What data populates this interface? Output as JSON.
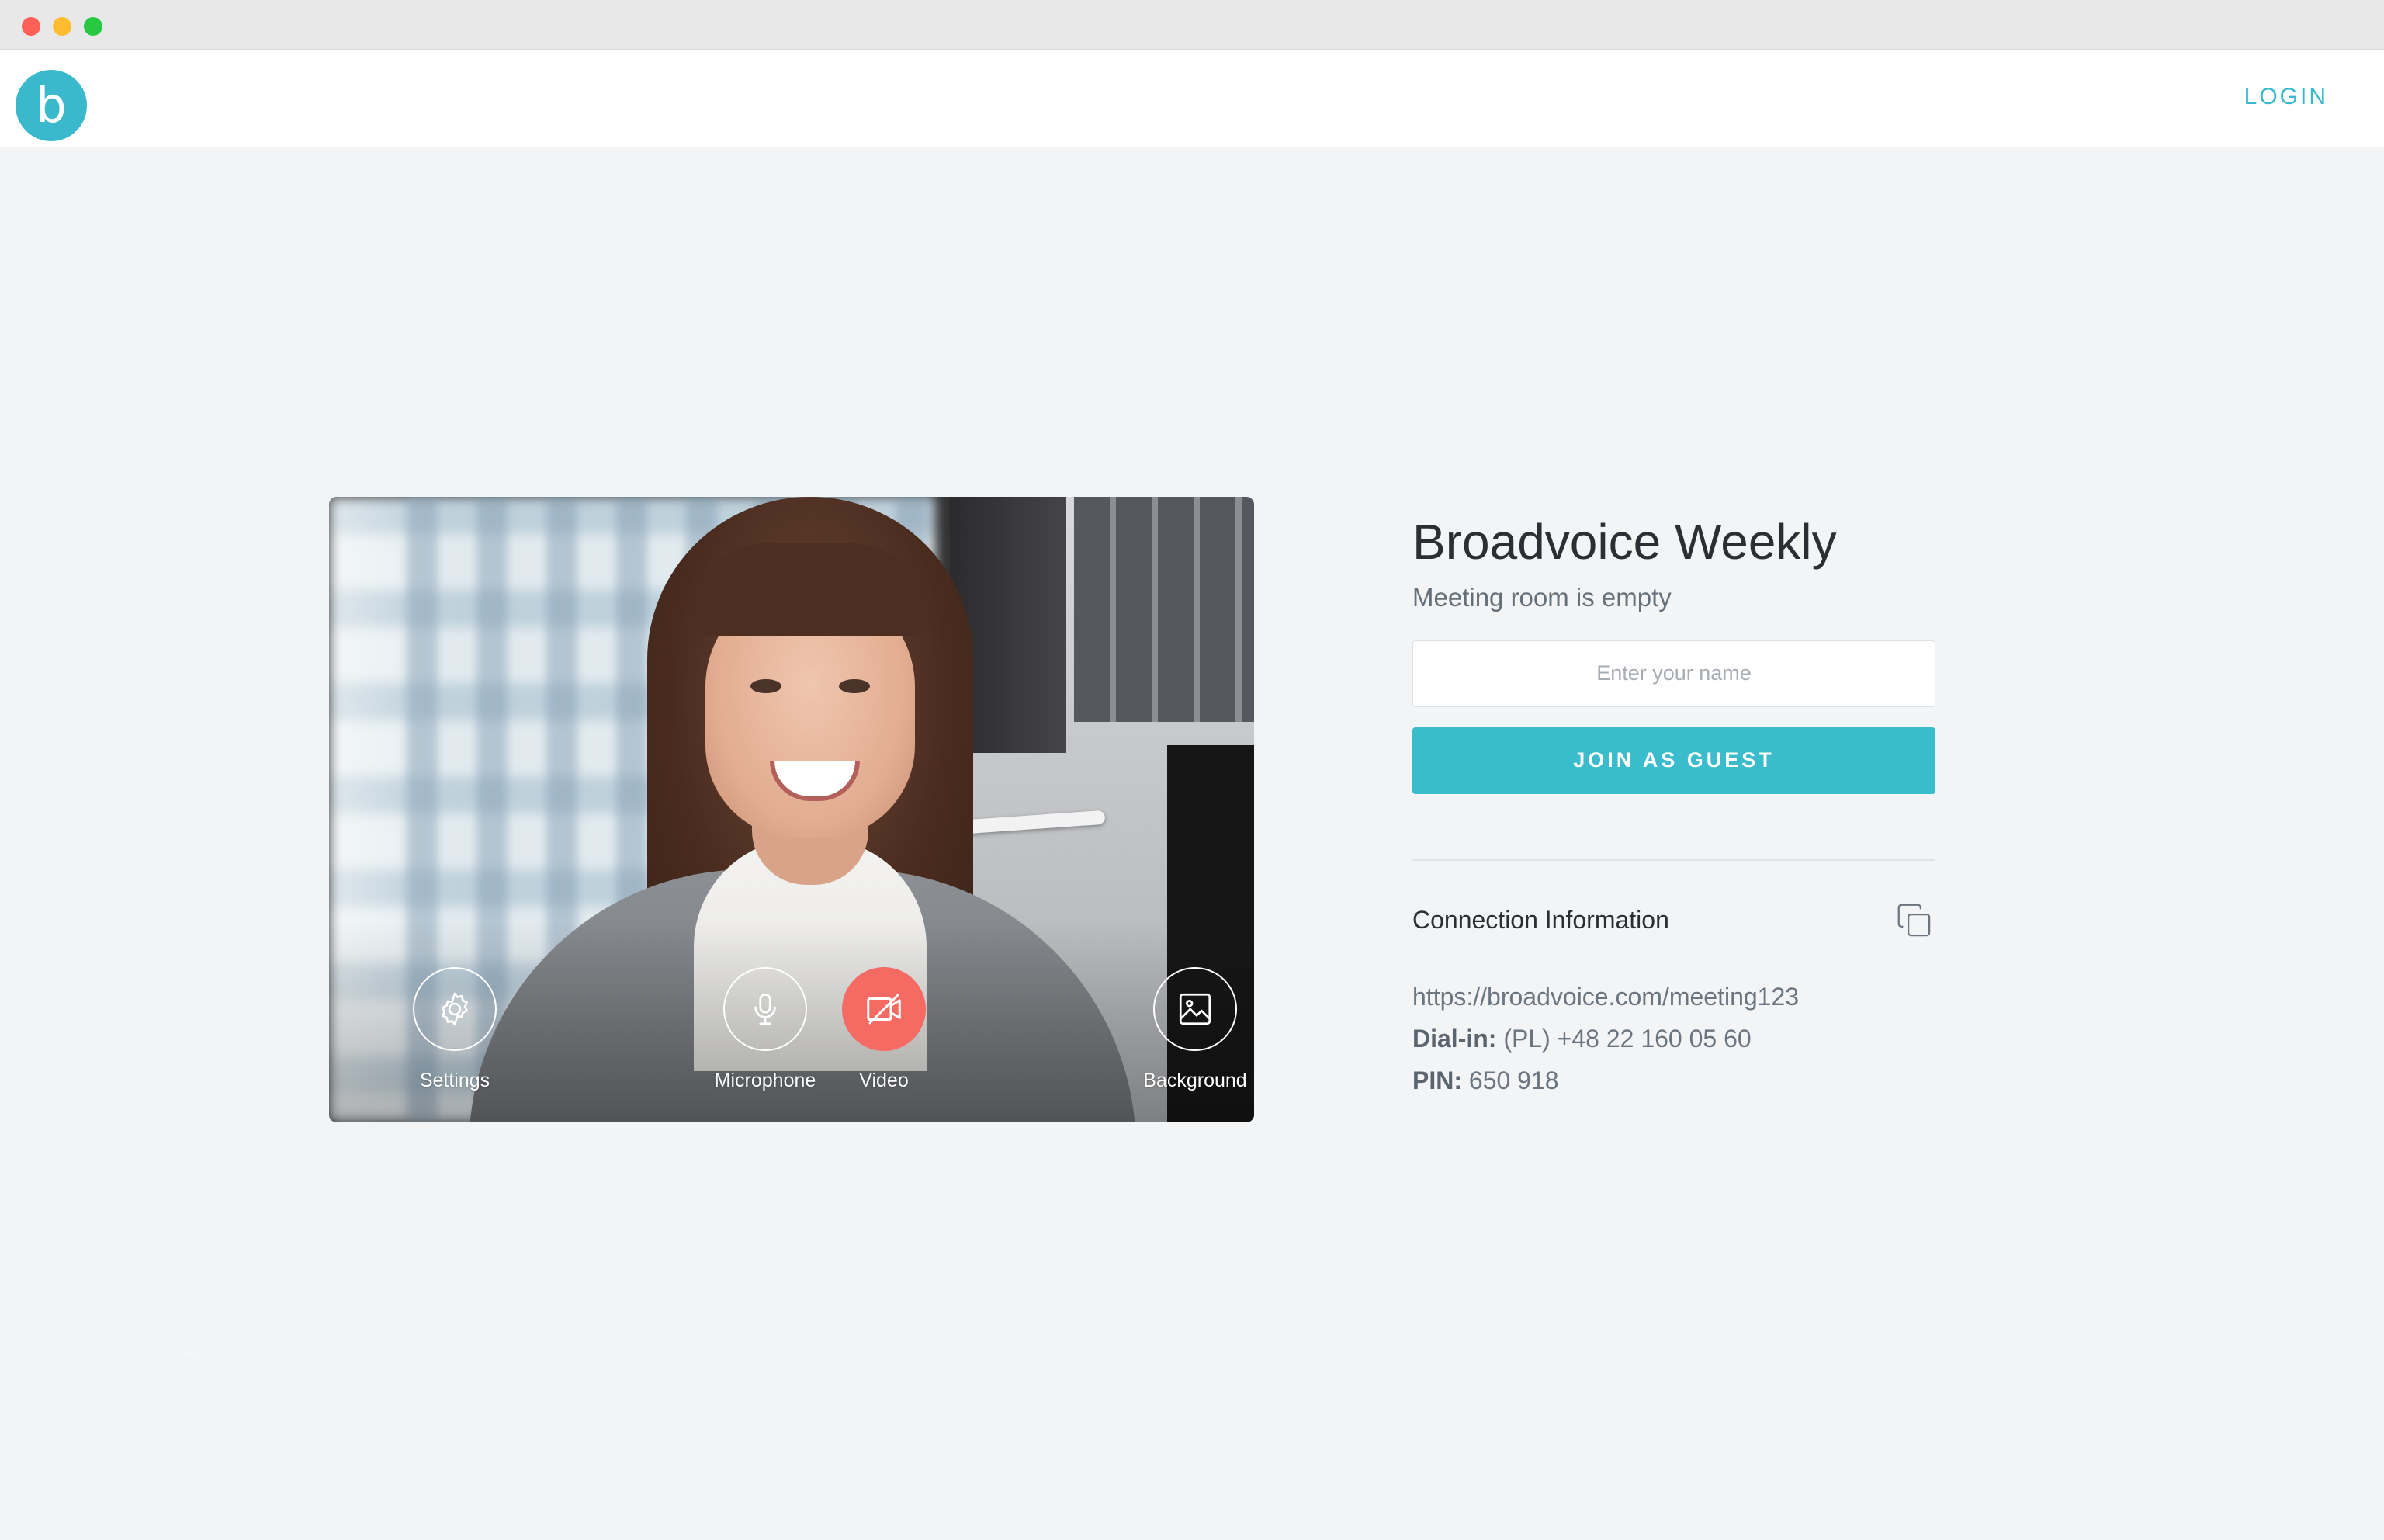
{
  "window": {
    "traffic_lights": [
      "close",
      "minimize",
      "zoom"
    ]
  },
  "header": {
    "logo_letter": "b",
    "login_label": "LOGIN"
  },
  "video_preview": {
    "controls": [
      {
        "label": "Settings",
        "icon": "gear-icon",
        "active": false
      },
      {
        "label": "Microphone",
        "icon": "microphone-icon",
        "active": false
      },
      {
        "label": "Video",
        "icon": "video-off-icon",
        "active": true
      },
      {
        "label": "Background",
        "icon": "image-icon",
        "active": false
      }
    ]
  },
  "meeting": {
    "title": "Broadvoice Weekly",
    "status": "Meeting room is empty",
    "name_placeholder": "Enter your name",
    "join_label": "JOIN AS GUEST"
  },
  "connection": {
    "title": "Connection Information",
    "copy_icon": "copy-icon",
    "url": "https://broadvoice.com/meeting123",
    "dial_in_label": "Dial-in:",
    "dial_in_value": " (PL) +48 22 160 05 60",
    "pin_label": "PIN:",
    "pin_value": " 650 918"
  },
  "misc": {
    "dots": "..."
  },
  "colors": {
    "accent": "#3bbccc",
    "video_off": "#f56a62",
    "background": "#f3f4f6"
  }
}
